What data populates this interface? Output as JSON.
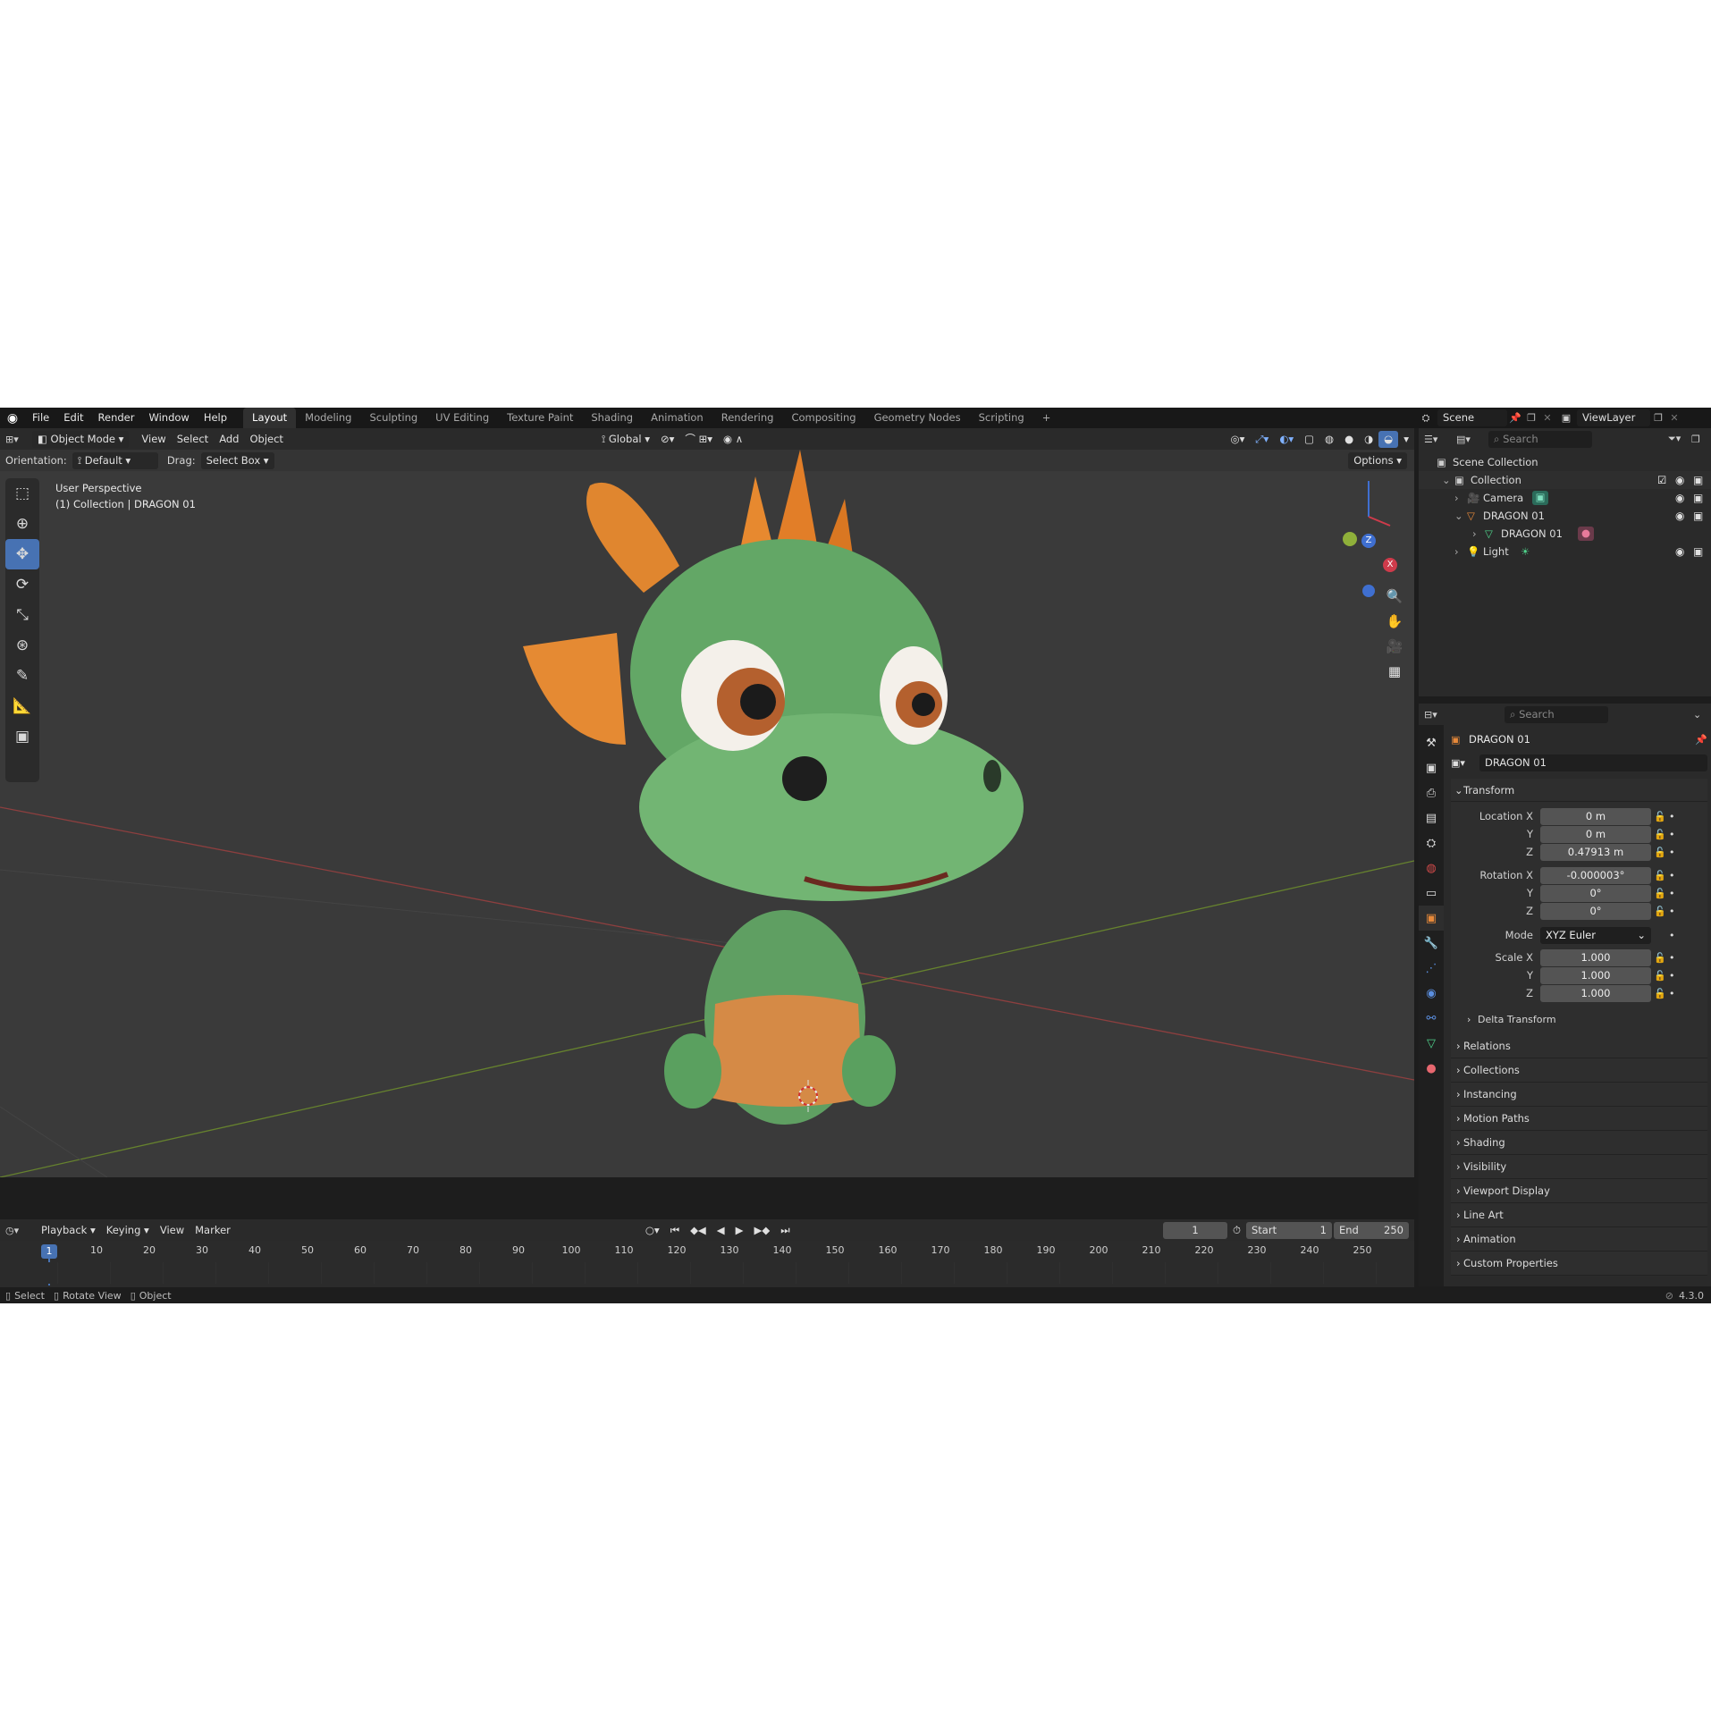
{
  "topbar": {
    "menus": [
      "File",
      "Edit",
      "Render",
      "Window",
      "Help"
    ],
    "workspaces": [
      "Layout",
      "Modeling",
      "Sculpting",
      "UV Editing",
      "Texture Paint",
      "Shading",
      "Animation",
      "Rendering",
      "Compositing",
      "Geometry Nodes",
      "Scripting"
    ],
    "active_workspace": "Layout",
    "add_tab": "+",
    "scene": "Scene",
    "view_layer": "ViewLayer"
  },
  "viewport_header": {
    "mode": "Object Mode",
    "menus": [
      "View",
      "Select",
      "Add",
      "Object"
    ],
    "orientation_transform": "Global",
    "orientation_label": "Orientation:",
    "orientation_value": "Default",
    "drag_label": "Drag:",
    "drag_value": "Select Box",
    "options": "Options"
  },
  "viewport": {
    "perspective": "User Perspective",
    "collection_info": "(1) Collection | DRAGON 01",
    "gizmo": {
      "z": "Z",
      "x": "X"
    },
    "colors": {
      "bg": "#3a3a3a",
      "grid_x": "#a34040",
      "grid_y": "#6a8a2c",
      "dragon_green": "#6fae6f",
      "dragon_orange": "#e0862f"
    }
  },
  "outliner": {
    "search_placeholder": "Search",
    "root": "Scene Collection",
    "items": [
      {
        "label": "Collection",
        "level": 0
      },
      {
        "label": "Camera",
        "level": 1
      },
      {
        "label": "DRAGON 01",
        "level": 1
      },
      {
        "label": "DRAGON 01",
        "level": 2
      },
      {
        "label": "Light",
        "level": 1
      }
    ]
  },
  "properties": {
    "search_placeholder": "Search",
    "object_name": "DRAGON 01",
    "object_field": "DRAGON 01",
    "transform_title": "Transform",
    "location": {
      "label": "Location X",
      "x": "0 m",
      "y": "0 m",
      "z": "0.47913 m"
    },
    "rotation": {
      "label": "Rotation X",
      "x": "-0.000003°",
      "y": "0°",
      "z": "0°"
    },
    "mode": {
      "label": "Mode",
      "value": "XYZ Euler"
    },
    "scale": {
      "label": "Scale X",
      "x": "1.000",
      "y": "1.000",
      "z": "1.000"
    },
    "axis_y": "Y",
    "axis_z": "Z",
    "delta": "Delta Transform",
    "panels": [
      "Relations",
      "Collections",
      "Instancing",
      "Motion Paths",
      "Shading",
      "Visibility",
      "Viewport Display",
      "Line Art",
      "Animation",
      "Custom Properties"
    ]
  },
  "timeline": {
    "menus": [
      "Playback",
      "Keying",
      "View",
      "Marker"
    ],
    "current_frame": "1",
    "start_label": "Start",
    "start": "1",
    "end_label": "End",
    "end": "250",
    "ticks": [
      "10",
      "20",
      "30",
      "40",
      "50",
      "60",
      "70",
      "80",
      "90",
      "100",
      "110",
      "120",
      "130",
      "140",
      "150",
      "160",
      "170",
      "180",
      "190",
      "200",
      "210",
      "220",
      "230",
      "240",
      "250"
    ],
    "playhead": "1"
  },
  "statusbar": {
    "items": [
      "Select",
      "Rotate View",
      "Object"
    ],
    "version": "4.3.0"
  }
}
